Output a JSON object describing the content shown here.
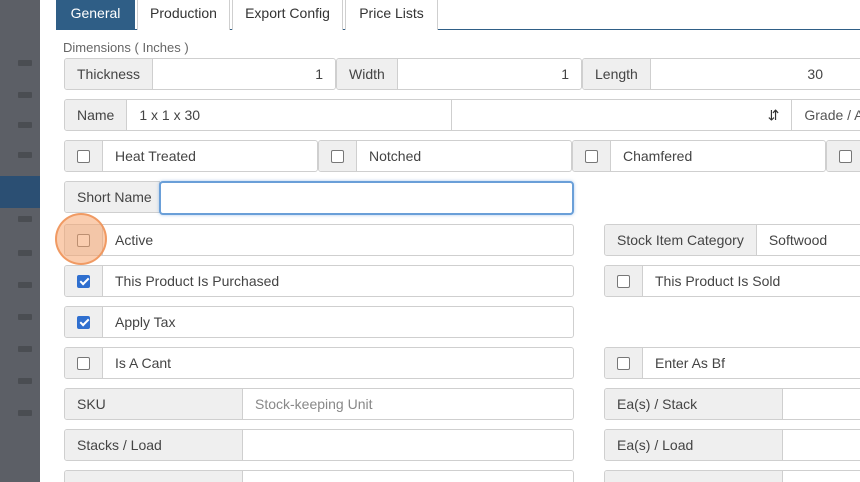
{
  "tabs": [
    {
      "label": "General"
    },
    {
      "label": "Production"
    },
    {
      "label": "Export Config"
    },
    {
      "label": "Price Lists"
    }
  ],
  "dimensions": {
    "section_label": "Dimensions ( Inches )",
    "thickness": {
      "label": "Thickness",
      "value": "1"
    },
    "width": {
      "label": "Width",
      "value": "1"
    },
    "length": {
      "label": "Length",
      "value": "30"
    }
  },
  "name": {
    "label": "Name",
    "value": "1 x 1 x 30"
  },
  "grade_label": "Grade / A",
  "treatments": {
    "heat_treated": "Heat Treated",
    "notched": "Notched",
    "chamfered": "Chamfered"
  },
  "short_name": {
    "label": "Short Name",
    "value": ""
  },
  "active": {
    "label": "Active",
    "checked": false
  },
  "stock_item_category": {
    "label": "Stock Item Category",
    "value": "Softwood"
  },
  "purchased": {
    "label": "This Product Is Purchased",
    "checked": true
  },
  "sold": {
    "label": "This Product Is Sold",
    "checked": false
  },
  "apply_tax": {
    "label": "Apply Tax",
    "checked": true
  },
  "is_a_cant": {
    "label": "Is A Cant",
    "checked": false
  },
  "enter_as_bf": {
    "label": "Enter As Bf",
    "checked": false
  },
  "sku": {
    "label": "SKU",
    "placeholder": "Stock-keeping Unit"
  },
  "ea_stack": {
    "label": "Ea(s) / Stack"
  },
  "stacks_load": {
    "label": "Stacks / Load"
  },
  "ea_load": {
    "label": "Ea(s) / Load"
  },
  "colors": {
    "accent": "#2f5e86",
    "check": "#2f6fcf",
    "focus": "#f5a46e"
  }
}
